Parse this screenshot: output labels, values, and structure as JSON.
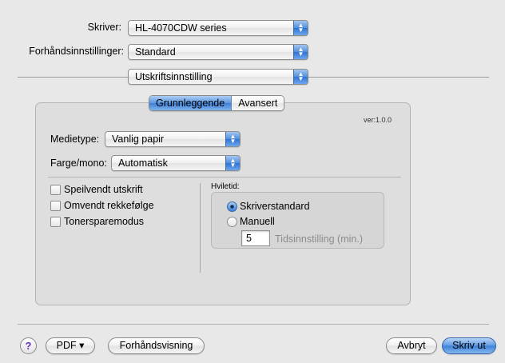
{
  "printer": {
    "label": "Skriver:",
    "value": "HL-4070CDW series"
  },
  "presets": {
    "label": "Forhåndsinnstillinger:",
    "value": "Standard"
  },
  "section": {
    "value": "Utskriftsinnstilling"
  },
  "tabs": [
    {
      "label": "Grunnleggende",
      "selected": true
    },
    {
      "label": "Avansert",
      "selected": false
    }
  ],
  "version": "ver:1.0.0",
  "media_type": {
    "label": "Medietype:",
    "value": "Vanlig papir"
  },
  "color_mode": {
    "label": "Farge/mono:",
    "value": "Automatisk"
  },
  "checkboxes": [
    {
      "label": "Speilvendt utskrift",
      "checked": false
    },
    {
      "label": "Omvendt rekkefølge",
      "checked": false
    },
    {
      "label": "Tonersparemodus",
      "checked": false
    }
  ],
  "sleep": {
    "title": "Hviletid:",
    "options": [
      {
        "label": "Skriverstandard",
        "selected": true
      },
      {
        "label": "Manuell",
        "selected": false
      }
    ],
    "time_value": "5",
    "time_label": "Tidsinnstilling (min.)"
  },
  "footer": {
    "help": "?",
    "pdf": "PDF ▾",
    "preview": "Forhåndsvisning",
    "cancel": "Avbryt",
    "print": "Skriv ut"
  },
  "icons": {
    "popup_arrows": "up-down-arrows-icon",
    "help": "help-icon"
  },
  "colors": {
    "accent": "#3d80da",
    "window_bg": "#e8e8e8",
    "panel_bg": "#dedede"
  }
}
